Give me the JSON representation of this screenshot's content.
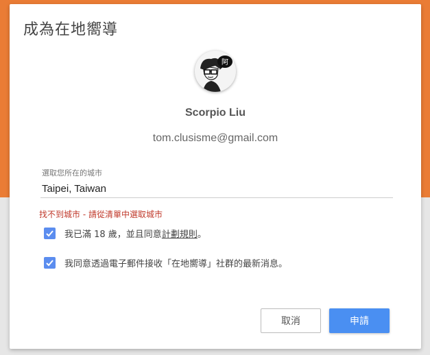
{
  "dialog": {
    "title": "成為在地嚮導"
  },
  "profile": {
    "avatar_icon": "cartoon-avatar-icon",
    "avatar_bubble_text": "阿",
    "name": "Scorpio Liu",
    "email": "tom.clusisme@gmail.com"
  },
  "city_field": {
    "label": "選取您所在的城市",
    "value": "Taipei, Taiwan",
    "error": "找不到城市 - 請從清單中選取城市"
  },
  "agreements": {
    "age_prefix": "我已滿 18 歲，並且同意",
    "age_link": "計劃規則",
    "age_suffix": "。",
    "age_checked": true,
    "email_opt_in": "我同意透過電子郵件接收「在地嚮導」社群的最新消息。",
    "email_checked": true
  },
  "buttons": {
    "cancel": "取消",
    "apply": "申請"
  },
  "colors": {
    "background_top": "#ea7c35",
    "accent": "#4a8ff2",
    "checkbox": "#5b8def",
    "error": "#c0392b"
  }
}
